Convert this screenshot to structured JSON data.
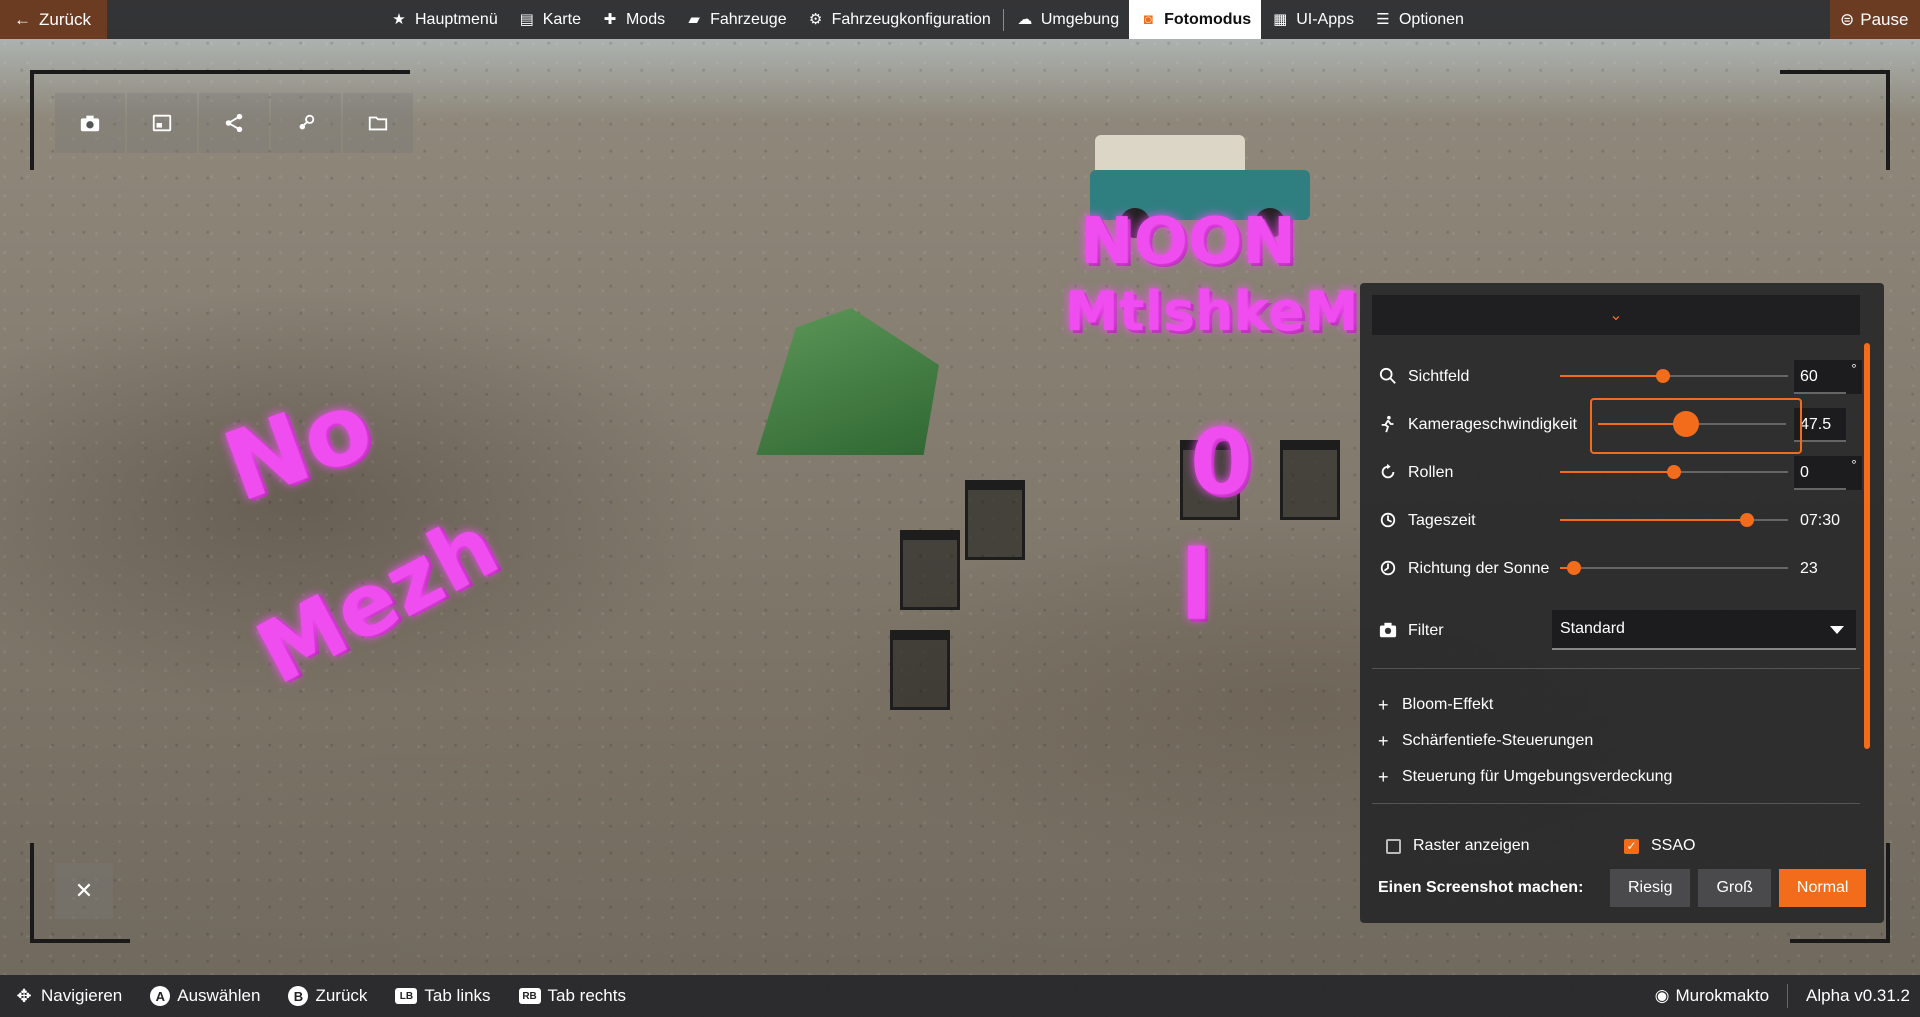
{
  "topbar": {
    "back_label": "Zurück",
    "pause_label": "Pause",
    "nav": [
      {
        "label": "Hauptmenü",
        "icon": "star-icon"
      },
      {
        "label": "Karte",
        "icon": "map-icon"
      },
      {
        "label": "Mods",
        "icon": "puzzle-icon"
      },
      {
        "label": "Fahrzeuge",
        "icon": "car-icon"
      },
      {
        "label": "Fahrzeugkonfiguration",
        "icon": "vehicle-config-icon"
      },
      {
        "label": "Umgebung",
        "icon": "weather-icon"
      },
      {
        "label": "Fotomodus",
        "icon": "camera-icon",
        "active": true
      },
      {
        "label": "UI-Apps",
        "icon": "apps-icon"
      },
      {
        "label": "Optionen",
        "icon": "sliders-icon"
      }
    ]
  },
  "scene_text": {
    "neon_left_1": "No",
    "neon_left_2": "Mezh",
    "neon_right_1": "NOON",
    "neon_right_2": "MtlshkeM"
  },
  "panel": {
    "rows": [
      {
        "label": "Sichtfeld",
        "value": "60",
        "unit": "°",
        "level": 0.45
      },
      {
        "label": "Kamerageschwindigkeit",
        "value": "47.5",
        "unit": "",
        "level": 0.47
      },
      {
        "label": "Rollen",
        "value": "0",
        "unit": "°",
        "level": 0.5
      },
      {
        "label": "Tageszeit",
        "value": "07:30",
        "unit": "",
        "level": 0.82
      },
      {
        "label": "Richtung der Sonne",
        "value": "23",
        "unit": "",
        "level": 0.06
      }
    ],
    "filter_label": "Filter",
    "filter_value": "Standard",
    "expanders": [
      "Bloom-Effekt",
      "Schärfentiefe-Steuerungen",
      "Steuerung für Umgebungsverdeckung"
    ],
    "grid_label": "Raster anzeigen",
    "grid_checked": false,
    "ssao_label": "SSAO",
    "ssao_checked": true,
    "screenshot_label": "Einen Screenshot machen:",
    "screenshot_sizes": [
      "Riesig",
      "Groß",
      "Normal"
    ],
    "screenshot_selected": "Normal"
  },
  "bottombar": {
    "hints": [
      {
        "key": "✥",
        "label": "Navigieren"
      },
      {
        "key": "A",
        "label": "Auswählen"
      },
      {
        "key": "B",
        "label": "Zurück"
      },
      {
        "key": "LB",
        "label": "Tab links"
      },
      {
        "key": "RB",
        "label": "Tab rechts"
      }
    ],
    "user": "Murokmakto",
    "version": "Alpha v0.31.2"
  },
  "colors": {
    "accent": "#f26c1b",
    "bar_bg": "#28282a",
    "back_bg": "#6b3b22"
  }
}
